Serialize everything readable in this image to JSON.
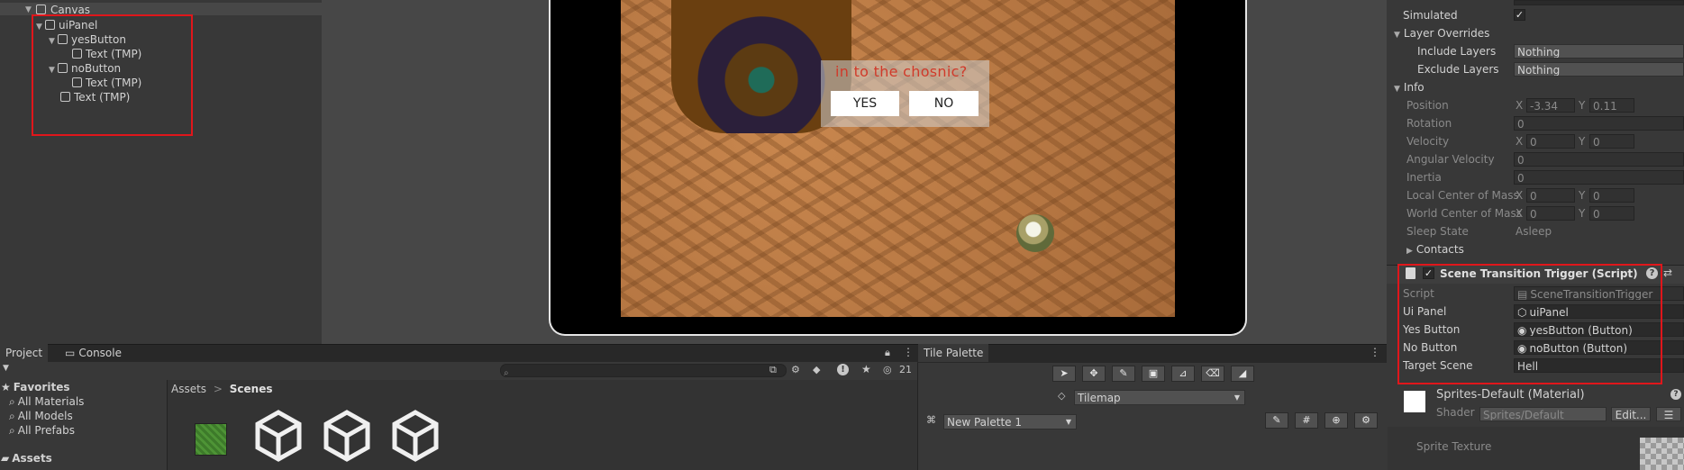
{
  "hierarchy": {
    "items": [
      {
        "label": "Canvas"
      },
      {
        "label": "uiPanel"
      },
      {
        "label": "yesButton"
      },
      {
        "label": "Text (TMP)"
      },
      {
        "label": "noButton"
      },
      {
        "label": "Text (TMP)"
      },
      {
        "label": "Text (TMP)"
      }
    ]
  },
  "game": {
    "dialog_text": "in to the chosnic?",
    "yes_label": "YES",
    "no_label": "NO"
  },
  "inspector": {
    "simulated_label": "Simulated",
    "layer_overrides_label": "Layer Overrides",
    "include_layers_label": "Include Layers",
    "include_layers_value": "Nothing",
    "exclude_layers_label": "Exclude Layers",
    "exclude_layers_value": "Nothing",
    "info_label": "Info",
    "position_label": "Position",
    "position_x": "-3.34",
    "position_y": "0.11",
    "rotation_label": "Rotation",
    "rotation_value": "0",
    "velocity_label": "Velocity",
    "velocity_x": "0",
    "velocity_y": "0",
    "angular_velocity_label": "Angular Velocity",
    "angular_velocity_value": "0",
    "inertia_label": "Inertia",
    "inertia_value": "0",
    "local_com_label": "Local Center of Mass",
    "local_com_x": "0",
    "local_com_y": "0",
    "world_com_label": "World Center of Mass",
    "world_com_x": "0",
    "world_com_y": "0",
    "sleep_state_label": "Sleep State",
    "sleep_state_value": "Asleep",
    "contacts_label": "Contacts",
    "x_letter": "X",
    "y_letter": "Y",
    "script_component_title": "Scene Transition Trigger (Script)",
    "script_label": "Script",
    "script_value": "SceneTransitionTrigger",
    "ui_panel_label": "Ui Panel",
    "ui_panel_value": "uiPanel",
    "yes_button_label": "Yes Button",
    "yes_button_value": "yesButton (Button)",
    "no_button_label": "No Button",
    "no_button_value": "noButton (Button)",
    "target_scene_label": "Target Scene",
    "target_scene_value": "Hell",
    "material_title": "Sprites-Default (Material)",
    "shader_label": "Shader",
    "shader_value": "Sprites/Default",
    "edit_label": "Edit...",
    "sprite_texture_label": "Sprite Texture"
  },
  "project": {
    "tab_project": "Project",
    "tab_console": "Console",
    "favorites_label": "Favorites",
    "favorites": [
      "All Materials",
      "All Models",
      "All Prefabs"
    ],
    "assets_label": "Assets",
    "breadcrumb_root": "Assets",
    "breadcrumb_current": "Scenes",
    "hidden_count": "21",
    "search_placeholder": ""
  },
  "tile_palette": {
    "tab_label": "Tile Palette",
    "tilemap_value": "Tilemap",
    "palette_value": "New Palette 1"
  },
  "colors": {
    "highlight_red": "#e0161b",
    "dialog_text_red": "#d03a2a"
  }
}
